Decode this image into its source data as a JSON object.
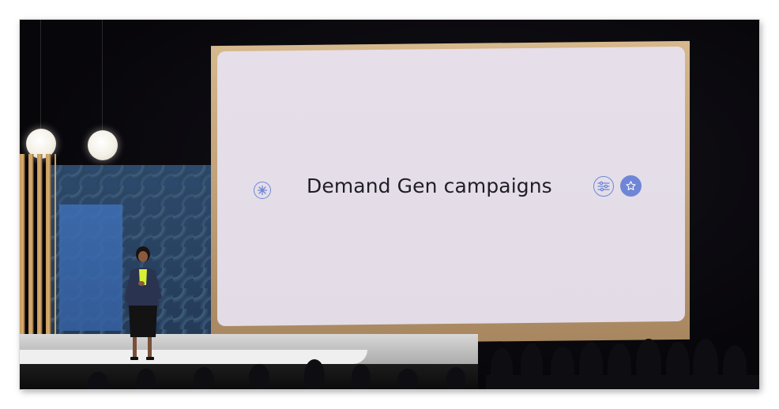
{
  "slide": {
    "title": "Demand Gen campaigns",
    "left_icon": "sparkle-icon",
    "right_icons": [
      "sliders-icon",
      "star-icon"
    ],
    "accent_color": "#6f86d6"
  }
}
